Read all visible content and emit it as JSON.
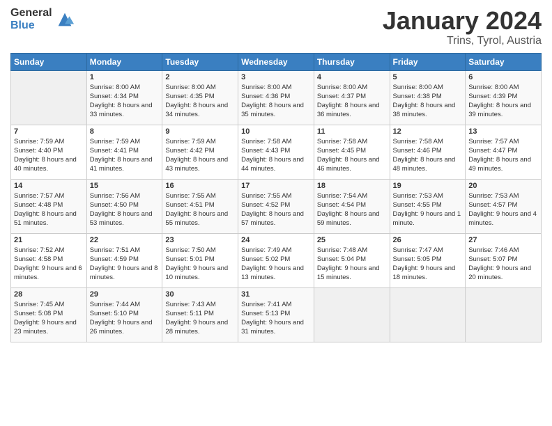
{
  "logo": {
    "general": "General",
    "blue": "Blue"
  },
  "title": "January 2024",
  "location": "Trins, Tyrol, Austria",
  "headers": [
    "Sunday",
    "Monday",
    "Tuesday",
    "Wednesday",
    "Thursday",
    "Friday",
    "Saturday"
  ],
  "weeks": [
    [
      {
        "day": "",
        "sunrise": "",
        "sunset": "",
        "daylight": "",
        "empty": true
      },
      {
        "day": "1",
        "sunrise": "Sunrise: 8:00 AM",
        "sunset": "Sunset: 4:34 PM",
        "daylight": "Daylight: 8 hours and 33 minutes."
      },
      {
        "day": "2",
        "sunrise": "Sunrise: 8:00 AM",
        "sunset": "Sunset: 4:35 PM",
        "daylight": "Daylight: 8 hours and 34 minutes."
      },
      {
        "day": "3",
        "sunrise": "Sunrise: 8:00 AM",
        "sunset": "Sunset: 4:36 PM",
        "daylight": "Daylight: 8 hours and 35 minutes."
      },
      {
        "day": "4",
        "sunrise": "Sunrise: 8:00 AM",
        "sunset": "Sunset: 4:37 PM",
        "daylight": "Daylight: 8 hours and 36 minutes."
      },
      {
        "day": "5",
        "sunrise": "Sunrise: 8:00 AM",
        "sunset": "Sunset: 4:38 PM",
        "daylight": "Daylight: 8 hours and 38 minutes."
      },
      {
        "day": "6",
        "sunrise": "Sunrise: 8:00 AM",
        "sunset": "Sunset: 4:39 PM",
        "daylight": "Daylight: 8 hours and 39 minutes."
      }
    ],
    [
      {
        "day": "7",
        "sunrise": "Sunrise: 7:59 AM",
        "sunset": "Sunset: 4:40 PM",
        "daylight": "Daylight: 8 hours and 40 minutes."
      },
      {
        "day": "8",
        "sunrise": "Sunrise: 7:59 AM",
        "sunset": "Sunset: 4:41 PM",
        "daylight": "Daylight: 8 hours and 41 minutes."
      },
      {
        "day": "9",
        "sunrise": "Sunrise: 7:59 AM",
        "sunset": "Sunset: 4:42 PM",
        "daylight": "Daylight: 8 hours and 43 minutes."
      },
      {
        "day": "10",
        "sunrise": "Sunrise: 7:58 AM",
        "sunset": "Sunset: 4:43 PM",
        "daylight": "Daylight: 8 hours and 44 minutes."
      },
      {
        "day": "11",
        "sunrise": "Sunrise: 7:58 AM",
        "sunset": "Sunset: 4:45 PM",
        "daylight": "Daylight: 8 hours and 46 minutes."
      },
      {
        "day": "12",
        "sunrise": "Sunrise: 7:58 AM",
        "sunset": "Sunset: 4:46 PM",
        "daylight": "Daylight: 8 hours and 48 minutes."
      },
      {
        "day": "13",
        "sunrise": "Sunrise: 7:57 AM",
        "sunset": "Sunset: 4:47 PM",
        "daylight": "Daylight: 8 hours and 49 minutes."
      }
    ],
    [
      {
        "day": "14",
        "sunrise": "Sunrise: 7:57 AM",
        "sunset": "Sunset: 4:48 PM",
        "daylight": "Daylight: 8 hours and 51 minutes."
      },
      {
        "day": "15",
        "sunrise": "Sunrise: 7:56 AM",
        "sunset": "Sunset: 4:50 PM",
        "daylight": "Daylight: 8 hours and 53 minutes."
      },
      {
        "day": "16",
        "sunrise": "Sunrise: 7:55 AM",
        "sunset": "Sunset: 4:51 PM",
        "daylight": "Daylight: 8 hours and 55 minutes."
      },
      {
        "day": "17",
        "sunrise": "Sunrise: 7:55 AM",
        "sunset": "Sunset: 4:52 PM",
        "daylight": "Daylight: 8 hours and 57 minutes."
      },
      {
        "day": "18",
        "sunrise": "Sunrise: 7:54 AM",
        "sunset": "Sunset: 4:54 PM",
        "daylight": "Daylight: 8 hours and 59 minutes."
      },
      {
        "day": "19",
        "sunrise": "Sunrise: 7:53 AM",
        "sunset": "Sunset: 4:55 PM",
        "daylight": "Daylight: 9 hours and 1 minute."
      },
      {
        "day": "20",
        "sunrise": "Sunrise: 7:53 AM",
        "sunset": "Sunset: 4:57 PM",
        "daylight": "Daylight: 9 hours and 4 minutes."
      }
    ],
    [
      {
        "day": "21",
        "sunrise": "Sunrise: 7:52 AM",
        "sunset": "Sunset: 4:58 PM",
        "daylight": "Daylight: 9 hours and 6 minutes."
      },
      {
        "day": "22",
        "sunrise": "Sunrise: 7:51 AM",
        "sunset": "Sunset: 4:59 PM",
        "daylight": "Daylight: 9 hours and 8 minutes."
      },
      {
        "day": "23",
        "sunrise": "Sunrise: 7:50 AM",
        "sunset": "Sunset: 5:01 PM",
        "daylight": "Daylight: 9 hours and 10 minutes."
      },
      {
        "day": "24",
        "sunrise": "Sunrise: 7:49 AM",
        "sunset": "Sunset: 5:02 PM",
        "daylight": "Daylight: 9 hours and 13 minutes."
      },
      {
        "day": "25",
        "sunrise": "Sunrise: 7:48 AM",
        "sunset": "Sunset: 5:04 PM",
        "daylight": "Daylight: 9 hours and 15 minutes."
      },
      {
        "day": "26",
        "sunrise": "Sunrise: 7:47 AM",
        "sunset": "Sunset: 5:05 PM",
        "daylight": "Daylight: 9 hours and 18 minutes."
      },
      {
        "day": "27",
        "sunrise": "Sunrise: 7:46 AM",
        "sunset": "Sunset: 5:07 PM",
        "daylight": "Daylight: 9 hours and 20 minutes."
      }
    ],
    [
      {
        "day": "28",
        "sunrise": "Sunrise: 7:45 AM",
        "sunset": "Sunset: 5:08 PM",
        "daylight": "Daylight: 9 hours and 23 minutes."
      },
      {
        "day": "29",
        "sunrise": "Sunrise: 7:44 AM",
        "sunset": "Sunset: 5:10 PM",
        "daylight": "Daylight: 9 hours and 26 minutes."
      },
      {
        "day": "30",
        "sunrise": "Sunrise: 7:43 AM",
        "sunset": "Sunset: 5:11 PM",
        "daylight": "Daylight: 9 hours and 28 minutes."
      },
      {
        "day": "31",
        "sunrise": "Sunrise: 7:41 AM",
        "sunset": "Sunset: 5:13 PM",
        "daylight": "Daylight: 9 hours and 31 minutes."
      },
      {
        "day": "",
        "sunrise": "",
        "sunset": "",
        "daylight": "",
        "empty": true
      },
      {
        "day": "",
        "sunrise": "",
        "sunset": "",
        "daylight": "",
        "empty": true
      },
      {
        "day": "",
        "sunrise": "",
        "sunset": "",
        "daylight": "",
        "empty": true
      }
    ]
  ]
}
